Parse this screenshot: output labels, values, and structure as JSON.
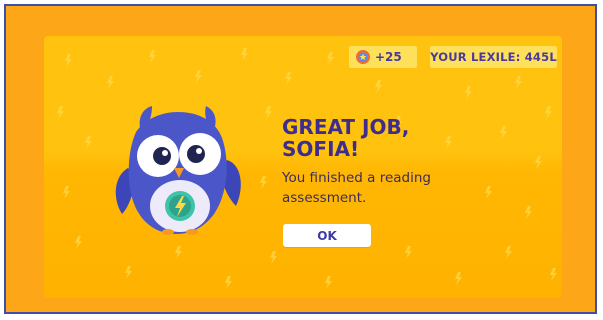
{
  "header": {
    "points": "+25",
    "points_icon": "badge-icon",
    "lexile": "YOUR LEXILE: 445L"
  },
  "dialog": {
    "title_line1": "GREAT JOB,",
    "title_line2": "SOFIA!",
    "message": "You finished a reading assessment.",
    "ok_label": "OK",
    "mascot": "owl-mascot"
  },
  "colors": {
    "frame_border": "#3D4FA8",
    "frame_background": "#FDA618",
    "card_background": "#FFC20E",
    "title_text": "#3F2D8E",
    "pill_background": "#FFE05A",
    "owl_body": "#4B57C9"
  }
}
